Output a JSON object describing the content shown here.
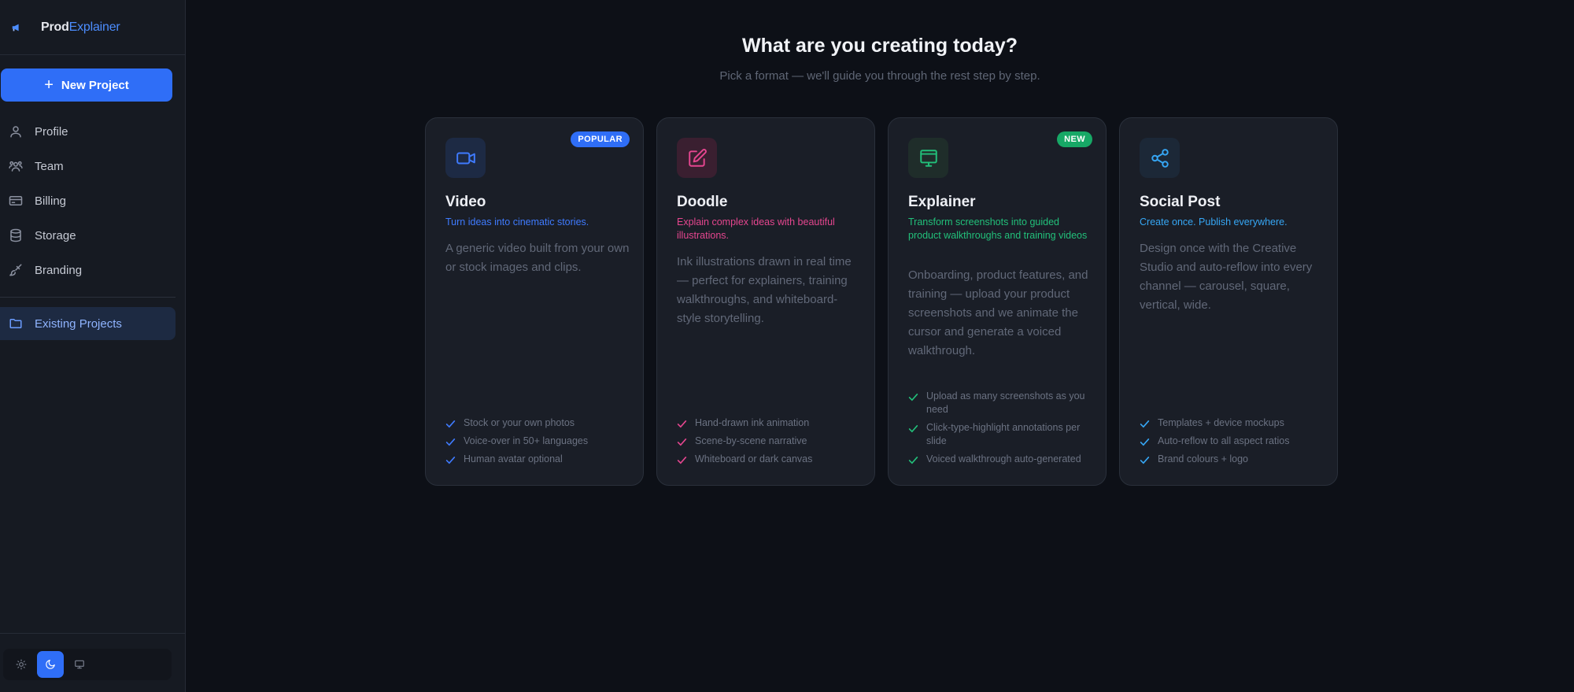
{
  "brand": {
    "name_a": "Prod",
    "name_b": "Explainer"
  },
  "sidebar": {
    "new_project": "New Project",
    "items": [
      {
        "label": "Profile",
        "icon": "user-icon"
      },
      {
        "label": "Team",
        "icon": "users-icon"
      },
      {
        "label": "Billing",
        "icon": "credit-card-icon"
      },
      {
        "label": "Storage",
        "icon": "database-icon"
      },
      {
        "label": "Branding",
        "icon": "brush-icon"
      }
    ],
    "existing_projects": "Existing Projects",
    "theme": {
      "options": [
        "light",
        "dark",
        "system"
      ],
      "selected": "dark"
    }
  },
  "main": {
    "title": "What are you creating today?",
    "subtitle": "Pick a format — we'll guide you through the rest step by step."
  },
  "colors": {
    "accent": "#2f6ef7",
    "video": "#3f7bff",
    "doodle": "#e5468f",
    "explainer": "#22c07a",
    "social": "#36a7f5"
  },
  "cards": [
    {
      "title": "Video",
      "badge": "POPULAR",
      "tagline": "Turn ideas into cinematic stories.",
      "description": "A generic video built from your own or stock images and clips.",
      "features": [
        "Stock or your own photos",
        "Voice-over in 50+ languages",
        "Human avatar optional"
      ],
      "icon": "video-camera-icon"
    },
    {
      "title": "Doodle",
      "badge": "",
      "tagline": "Explain complex ideas with beautiful illustrations.",
      "description": "Ink illustrations drawn in real time — perfect for explainers, training walkthroughs, and whiteboard-style storytelling.",
      "features": [
        "Hand-drawn ink animation",
        "Scene-by-scene narrative",
        "Whiteboard or dark canvas"
      ],
      "icon": "pencil-square-icon"
    },
    {
      "title": "Explainer",
      "badge": "NEW",
      "tagline": "Transform screenshots into guided product walkthroughs and training videos",
      "description": "Onboarding, product features, and training — upload your product screenshots and we animate the cursor and generate a voiced walkthrough.",
      "features": [
        "Upload as many screenshots as you need",
        "Click-type-highlight annotations per slide",
        "Voiced walkthrough auto-generated"
      ],
      "icon": "monitor-icon"
    },
    {
      "title": "Social Post",
      "badge": "",
      "tagline": "Create once. Publish everywhere.",
      "description": "Design once with the Creative Studio and auto-reflow into every channel — carousel, square, vertical, wide.",
      "features": [
        "Templates + device mockups",
        "Auto-reflow to all aspect ratios",
        "Brand colours + logo"
      ],
      "icon": "share-icon"
    }
  ]
}
